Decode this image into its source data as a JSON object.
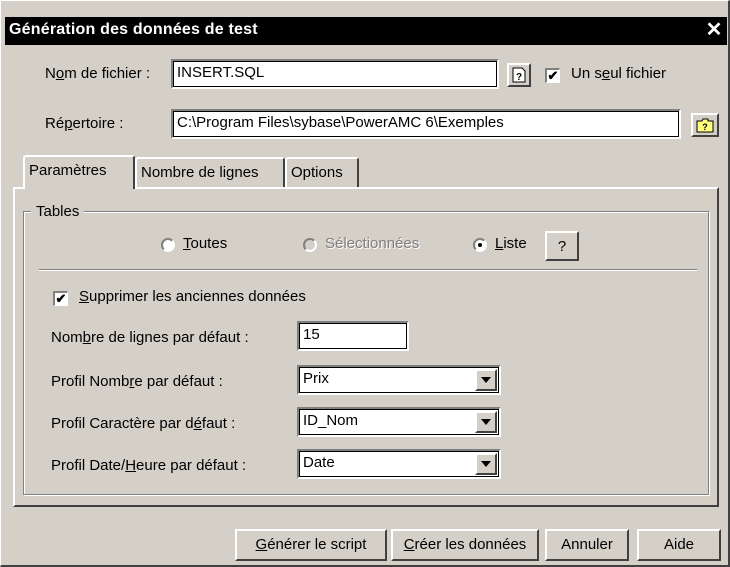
{
  "window": {
    "title": "Génération des données de test",
    "close_glyph": "✕"
  },
  "file": {
    "label_pre": "N",
    "label_u": "o",
    "label_post": "m de fichier :",
    "value": "INSERT.SQL",
    "browse_icon": "help-file-icon",
    "single_file_checked": true,
    "single_file_pre": "Un s",
    "single_file_u": "e",
    "single_file_post": "ul fichier"
  },
  "directory": {
    "label_pre": "Ré",
    "label_u": "p",
    "label_post": "ertoire :",
    "value": "C:\\Program Files\\sybase\\PowerAMC 6\\Exemples",
    "browse_icon": "folder-browse-icon"
  },
  "tabs": [
    {
      "label": "Paramètres",
      "active": true
    },
    {
      "label": "Nombre de lignes",
      "active": false
    },
    {
      "label": "Options",
      "active": false
    }
  ],
  "tables_group": {
    "legend": "Tables",
    "radio_all_u": "T",
    "radio_all_post": "outes",
    "radio_selected": "Sélectionnées",
    "radio_list_u": "L",
    "radio_list_post": "iste",
    "selected_option": "Liste",
    "help_label": "?"
  },
  "options": {
    "delete_checked": true,
    "delete_u": "S",
    "delete_post": "upprimer les anciennes données",
    "rows_label_pre": "Nom",
    "rows_label_u": "b",
    "rows_label_post": "re de lignes par défaut :",
    "rows_value": "15",
    "number_profile_pre": "Profil Nomb",
    "number_profile_u": "r",
    "number_profile_post": "e par défaut :",
    "number_profile_value": "Prix",
    "char_profile_pre": "Profil Caractère par d",
    "char_profile_u": "é",
    "char_profile_post": "faut :",
    "char_profile_value": "ID_Nom",
    "date_profile_pre": "Profil Date/",
    "date_profile_u": "H",
    "date_profile_post": "eure par défaut :",
    "date_profile_value": "Date"
  },
  "buttons": {
    "generate_u": "G",
    "generate_post": "énérer le script",
    "create_u": "C",
    "create_post": "réer les données",
    "cancel": "Annuler",
    "help": "Aide"
  }
}
